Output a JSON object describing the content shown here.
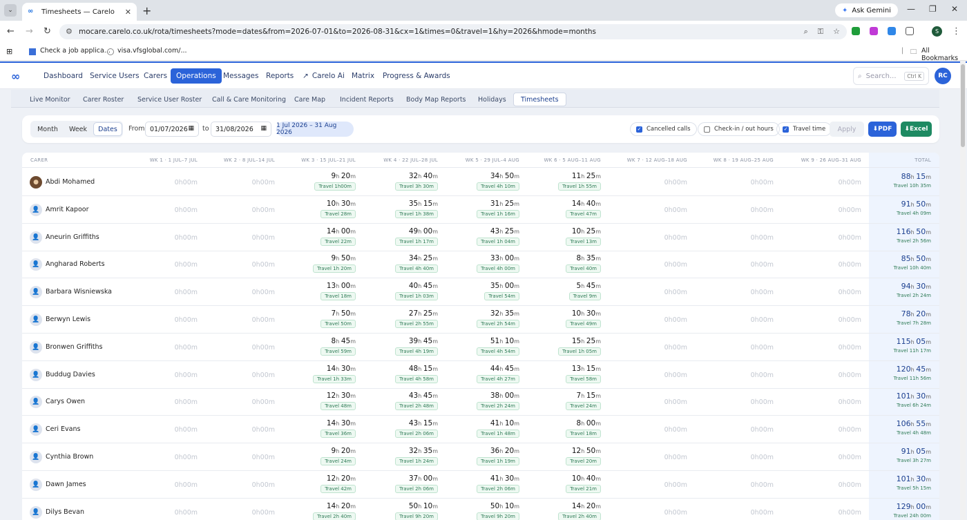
{
  "browser": {
    "tab_title": "Timesheets — Carelo",
    "url": "mocare.carelo.co.uk/rota/timesheets?mode=dates&from=2026-07-01&to=2026-08-31&cx=1&times=0&travel=1&hy=2026&hmode=months",
    "gemini_label": "Ask Gemini",
    "profile_initial": "S",
    "bookmarks": [
      "Check a job applica...",
      "visa.vfsglobal.com/..."
    ],
    "all_bookmarks": "All Bookmarks"
  },
  "app": {
    "nav": [
      "Dashboard",
      "Service Users",
      "Carers",
      "Operations",
      "Messages",
      "Reports",
      "Carelo Ai",
      "Matrix",
      "Progress & Awards"
    ],
    "active_nav": "Operations",
    "search_placeholder": "Search...",
    "search_shortcut": "Ctrl K",
    "user_initials": "RC",
    "subnav": [
      "Live Monitor",
      "Carer Roster",
      "Service User Roster",
      "Call & Care Monitoring",
      "Care Map",
      "Incident Reports",
      "Body Map Reports",
      "Holidays",
      "Timesheets"
    ],
    "active_subnav": "Timesheets"
  },
  "filters": {
    "modes": [
      "Month",
      "Week",
      "Dates"
    ],
    "active_mode": "Dates",
    "from_label": "From",
    "from_value": "01/07/2026",
    "to_label": "to",
    "to_value": "31/08/2026",
    "range_pill": "1 Jul 2026 – 31 Aug 2026",
    "toggles": [
      {
        "label": "Cancelled calls",
        "checked": true
      },
      {
        "label": "Check-in / out hours",
        "checked": false
      },
      {
        "label": "Travel time",
        "checked": true
      }
    ],
    "apply": "Apply",
    "pdf": "⬇PDF",
    "excel": "⬇Excel"
  },
  "table": {
    "carer_header": "CARER",
    "week_headers": [
      "WK 1 · 1 JUL–7 JUL",
      "WK 2 · 8 JUL–14 JUL",
      "WK 3 · 15 JUL–21 JUL",
      "WK 4 · 22 JUL–28 JUL",
      "WK 5 · 29 JUL–4 AUG",
      "WK 6 · 5 AUG–11 AUG",
      "WK 7 · 12 AUG–18 AUG",
      "WK 8 · 19 AUG–25 AUG",
      "WK 9 · 26 AUG–31 AUG"
    ],
    "total_header": "TOTAL",
    "zero_value": "0h00m",
    "rows": [
      {
        "name": "Abdi Mohamed",
        "photo": true,
        "weeks": [
          [
            "9",
            "20",
            "Travel 1h00m"
          ],
          [
            "32",
            "40",
            "Travel 3h 30m"
          ],
          [
            "34",
            "50",
            "Travel 4h 10m"
          ],
          [
            "11",
            "25",
            "Travel 1h 55m"
          ]
        ],
        "total": [
          "88",
          "15",
          "Travel 10h 35m"
        ]
      },
      {
        "name": "Amrit Kapoor",
        "weeks": [
          [
            "10",
            "30",
            "Travel 28m"
          ],
          [
            "35",
            "15",
            "Travel 1h 38m"
          ],
          [
            "31",
            "25",
            "Travel 1h 16m"
          ],
          [
            "14",
            "40",
            "Travel 47m"
          ]
        ],
        "total": [
          "91",
          "50",
          "Travel 4h 09m"
        ]
      },
      {
        "name": "Aneurin Griffiths",
        "weeks": [
          [
            "14",
            "00",
            "Travel 22m"
          ],
          [
            "49",
            "00",
            "Travel 1h 17m"
          ],
          [
            "43",
            "25",
            "Travel 1h 04m"
          ],
          [
            "10",
            "25",
            "Travel 13m"
          ]
        ],
        "total": [
          "116",
          "50",
          "Travel 2h 56m"
        ]
      },
      {
        "name": "Angharad Roberts",
        "weeks": [
          [
            "9",
            "50",
            "Travel 1h 20m"
          ],
          [
            "34",
            "25",
            "Travel 4h 40m"
          ],
          [
            "33",
            "00",
            "Travel 4h 00m"
          ],
          [
            "8",
            "35",
            "Travel 40m"
          ]
        ],
        "total": [
          "85",
          "50",
          "Travel 10h 40m"
        ]
      },
      {
        "name": "Barbara Wisniewska",
        "weeks": [
          [
            "13",
            "00",
            "Travel 18m"
          ],
          [
            "40",
            "45",
            "Travel 1h 03m"
          ],
          [
            "35",
            "00",
            "Travel 54m"
          ],
          [
            "5",
            "45",
            "Travel 9m"
          ]
        ],
        "total": [
          "94",
          "30",
          "Travel 2h 24m"
        ]
      },
      {
        "name": "Berwyn Lewis",
        "weeks": [
          [
            "7",
            "50",
            "Travel 50m"
          ],
          [
            "27",
            "25",
            "Travel 2h 55m"
          ],
          [
            "32",
            "35",
            "Travel 2h 54m"
          ],
          [
            "10",
            "30",
            "Travel 49m"
          ]
        ],
        "total": [
          "78",
          "20",
          "Travel 7h 28m"
        ]
      },
      {
        "name": "Bronwen Griffiths",
        "weeks": [
          [
            "8",
            "45",
            "Travel 59m"
          ],
          [
            "39",
            "45",
            "Travel 4h 19m"
          ],
          [
            "51",
            "10",
            "Travel 4h 54m"
          ],
          [
            "15",
            "25",
            "Travel 1h 05m"
          ]
        ],
        "total": [
          "115",
          "05",
          "Travel 11h 17m"
        ]
      },
      {
        "name": "Buddug Davies",
        "weeks": [
          [
            "14",
            "30",
            "Travel 1h 33m"
          ],
          [
            "48",
            "15",
            "Travel 4h 58m"
          ],
          [
            "44",
            "45",
            "Travel 4h 27m"
          ],
          [
            "13",
            "15",
            "Travel 58m"
          ]
        ],
        "total": [
          "120",
          "45",
          "Travel 11h 56m"
        ]
      },
      {
        "name": "Carys Owen",
        "weeks": [
          [
            "12",
            "30",
            "Travel 48m"
          ],
          [
            "43",
            "45",
            "Travel 2h 48m"
          ],
          [
            "38",
            "00",
            "Travel 2h 24m"
          ],
          [
            "7",
            "15",
            "Travel 24m"
          ]
        ],
        "total": [
          "101",
          "30",
          "Travel 6h 24m"
        ]
      },
      {
        "name": "Ceri Evans",
        "weeks": [
          [
            "14",
            "30",
            "Travel 36m"
          ],
          [
            "43",
            "15",
            "Travel 2h 06m"
          ],
          [
            "41",
            "10",
            "Travel 1h 48m"
          ],
          [
            "8",
            "00",
            "Travel 18m"
          ]
        ],
        "total": [
          "106",
          "55",
          "Travel 4h 48m"
        ]
      },
      {
        "name": "Cynthia Brown",
        "weeks": [
          [
            "9",
            "20",
            "Travel 24m"
          ],
          [
            "32",
            "35",
            "Travel 1h 24m"
          ],
          [
            "36",
            "20",
            "Travel 1h 19m"
          ],
          [
            "12",
            "50",
            "Travel 20m"
          ]
        ],
        "total": [
          "91",
          "05",
          "Travel 3h 27m"
        ]
      },
      {
        "name": "Dawn James",
        "weeks": [
          [
            "12",
            "20",
            "Travel 42m"
          ],
          [
            "37",
            "00",
            "Travel 2h 06m"
          ],
          [
            "41",
            "30",
            "Travel 2h 06m"
          ],
          [
            "10",
            "40",
            "Travel 21m"
          ]
        ],
        "total": [
          "101",
          "30",
          "Travel 5h 15m"
        ]
      },
      {
        "name": "Dilys Bevan",
        "weeks": [
          [
            "14",
            "20",
            "Travel 2h 40m"
          ],
          [
            "50",
            "10",
            "Travel 9h 20m"
          ],
          [
            "50",
            "10",
            "Travel 9h 20m"
          ],
          [
            "14",
            "20",
            "Travel 2h 40m"
          ]
        ],
        "total": [
          "129",
          "00",
          "Travel 24h 00m"
        ]
      }
    ]
  }
}
